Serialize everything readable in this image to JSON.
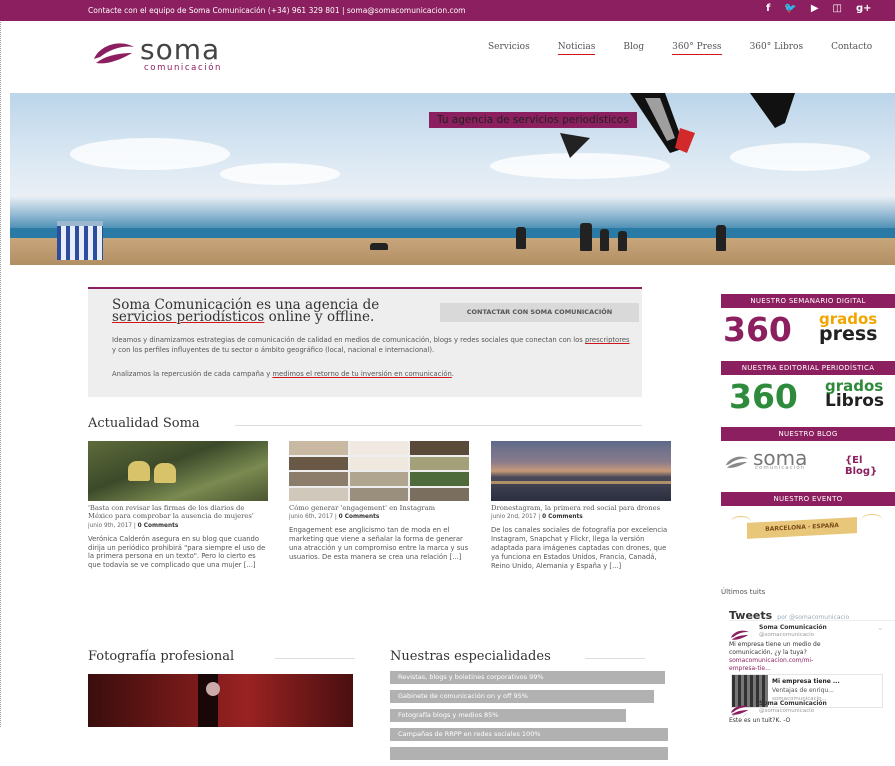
{
  "topbar": {
    "contact": "Contacte con el equipo de Soma Comunicación (+34) 961 329 801 | soma@somacomunicacion.com",
    "social": [
      "f",
      "🐦",
      "▶",
      "◫",
      "g+"
    ]
  },
  "logo": {
    "word": "soma",
    "sub": "comunicación"
  },
  "nav": [
    "Servicios",
    "Noticias",
    "Blog",
    "360° Press",
    "360° Libros",
    "Contacto"
  ],
  "hero": {
    "tagline": "Tu agencia de servicios periodísticos"
  },
  "intro": {
    "title_a": "Soma Comunicación es una agencia de ",
    "title_link": "servicios periodísticos",
    "title_b": " online y offline.",
    "button": "CONTACTAR CON SOMA COMUNICACIÓN",
    "p1_a": "Ideamos y dinamizamos estrategias de comunicación de calidad en medios de comunicación, blogs y redes sociales que conectan con los ",
    "p1_link": "prescriptores",
    "p1_b": " y con los perfiles influyentes de tu sector o ámbito geográfico (local, nacional e internacional).",
    "p2_a": "Analizamos la repercusión de cada campaña y ",
    "p2_link": "medimos el retorno de tu inversión en comunicación",
    "p2_b": "."
  },
  "actualidad": {
    "title": "Actualidad Soma",
    "posts": [
      {
        "title": "'Basta con revisar las firmas de los diarios de México para comprobar la ausencia de mujeres'",
        "date": "junio 9th, 2017 | ",
        "comments": "0 Comments",
        "excerpt": "Verónica Calderón asegura en su blog que cuando dirija un periódico prohibirá \"para siempre el uso de la primera persona en un texto\". Pero lo cierto es que todavía se ve complicado que una mujer [...]"
      },
      {
        "title": "Cómo generar 'engagement' en Instagram",
        "date": "junio 6th, 2017 | ",
        "comments": "0 Comments",
        "excerpt": "Engagement ese anglicismo tan de moda en el marketing que viene a señalar la forma de generar una atracción y un compromiso entre la marca y sus usuarios. De esta manera se crea una relación [...]"
      },
      {
        "title": "Dronestagram, la primera red social para drones",
        "date": "junio 2nd, 2017 | ",
        "comments": "0 Comments",
        "excerpt": "De los canales sociales de fotografía por excelencia Instagram, Snapchat y Flickr, llega la versión adaptada para imágenes captadas con drones, que ya funciona en Estados Unidos, Francia, Canadá, Reino Unido, Alemania y España y [...]"
      }
    ]
  },
  "foto": {
    "title": "Fotografía profesional"
  },
  "especialidades": {
    "title": "Nuestras especialidades",
    "items": [
      {
        "label": "Revistas, blogs y boletines corporativos 99%",
        "value": 99
      },
      {
        "label": "Gabinete de comunicación on y off 95%",
        "value": 95
      },
      {
        "label": "Fotografía blogs y medios 85%",
        "value": 85
      },
      {
        "label": "Campañas de RRPP en redes sociales 100%",
        "value": 100
      },
      {
        "label": "",
        "value": 100
      }
    ]
  },
  "sidebar": {
    "semanario": "NUESTRO SEMANARIO DIGITAL",
    "press_num": "360",
    "press_top": "grados",
    "press_bottom": "press",
    "editorial": "NUESTRA EDITORIAL PERIODÍSTICA",
    "libros_num": "360",
    "libros_top": "grados",
    "libros_bottom": "Libros",
    "blog": "NUESTRO BLOG",
    "blog_word": "soma",
    "blog_sub": "comunicación",
    "blog_tag": "{El Blog}",
    "evento": "NUESTRO EVENTO",
    "evento_banner": "BARCELONA · ESPAÑA",
    "ultimos": "Últimos tuits",
    "tweets_title": "Tweets",
    "tweets_by": "por @somacomunicacio"
  },
  "tweets": [
    {
      "name": "Soma Comunicación",
      "handle": "@somacomunicacio",
      "text": "Mi empresa tiene un medio de comunicación, ¿y la tuya?",
      "link": "somacomunicacion.com/mi-empresa-tie..."
    },
    {
      "card_title": "Mi empresa tiene ...",
      "card_sub": "Ventajas de enriqu...",
      "card_link": "somacomunicacio..."
    },
    {
      "name": "Soma Comunicación",
      "handle": "@somacomunicacio",
      "text": "Este es un tuit?K. -O"
    }
  ],
  "colors": {
    "brand": "#8b1f5f",
    "green": "#2e8b3c",
    "underline": "#d0161a"
  }
}
